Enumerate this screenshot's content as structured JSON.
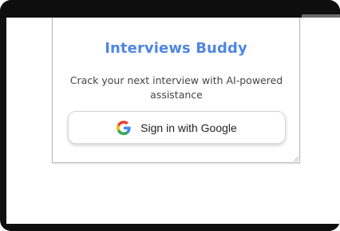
{
  "popup": {
    "title": "Interviews Buddy",
    "subtitle": "Crack your next interview with AI-powered assistance",
    "signin_label": "Sign in with Google",
    "signin_icon": "google-g-icon"
  },
  "colors": {
    "title": "#4e86e2",
    "frame": "#0e0e0e",
    "google_blue": "#4285F4",
    "google_red": "#EA4335",
    "google_yellow": "#FBBC05",
    "google_green": "#34A853"
  }
}
